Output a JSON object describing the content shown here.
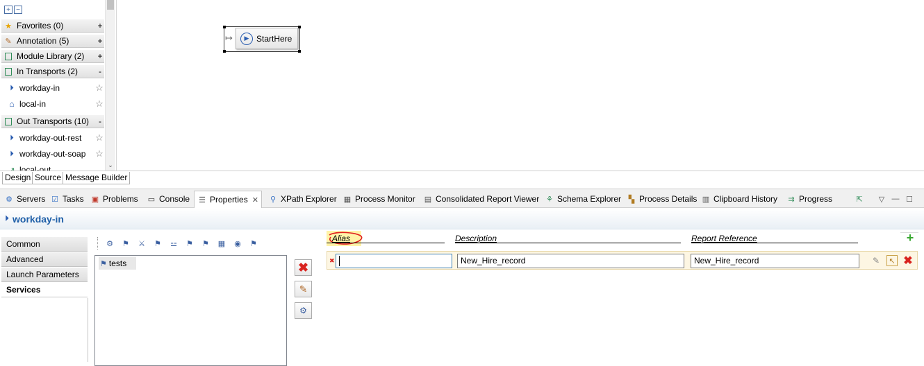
{
  "palette": {
    "groups": [
      {
        "label": "Favorites (0)",
        "toggle": "+"
      },
      {
        "label": "Annotation (5)",
        "toggle": "+"
      },
      {
        "label": "Module Library (2)",
        "toggle": "+"
      },
      {
        "label": "In Transports (2)",
        "toggle": "-"
      },
      {
        "label": "Out Transports (10)",
        "toggle": "-"
      }
    ],
    "in_items": [
      {
        "label": "workday-in"
      },
      {
        "label": "local-in"
      }
    ],
    "out_items": [
      {
        "label": "workday-out-rest"
      },
      {
        "label": "workday-out-soap"
      },
      {
        "label": "local-out"
      }
    ]
  },
  "canvas": {
    "node_label": "StartHere"
  },
  "design_tabs": [
    "Design",
    "Source",
    "Message Builder"
  ],
  "views": [
    {
      "label": "Servers",
      "icon": "servers-icon"
    },
    {
      "label": "Tasks",
      "icon": "tasks-icon"
    },
    {
      "label": "Problems",
      "icon": "problems-icon"
    },
    {
      "label": "Console",
      "icon": "console-icon"
    },
    {
      "label": "Properties",
      "icon": "properties-icon"
    },
    {
      "label": "XPath Explorer",
      "icon": "xpath-icon"
    },
    {
      "label": "Process Monitor",
      "icon": "process-monitor-icon"
    },
    {
      "label": "Consolidated Report Viewer",
      "icon": "report-icon"
    },
    {
      "label": "Schema Explorer",
      "icon": "schema-icon"
    },
    {
      "label": "Process Details",
      "icon": "process-details-icon"
    },
    {
      "label": "Clipboard History",
      "icon": "clipboard-icon"
    },
    {
      "label": "Progress",
      "icon": "progress-icon"
    }
  ],
  "properties": {
    "title": "workday-in",
    "left_tabs": [
      "Common",
      "Advanced",
      "Launch Parameters",
      "Services"
    ],
    "tree_item": "tests",
    "columns": [
      "Alias",
      "Description",
      "Report Reference"
    ],
    "row": {
      "alias": "",
      "description": "New_Hire_record",
      "report_reference": "New_Hire_record"
    }
  },
  "colors": {
    "title_blue": "#1f5fa8",
    "delete_red": "#d9231f",
    "add_green": "#3aa832",
    "annotation_red": "#e02020"
  }
}
